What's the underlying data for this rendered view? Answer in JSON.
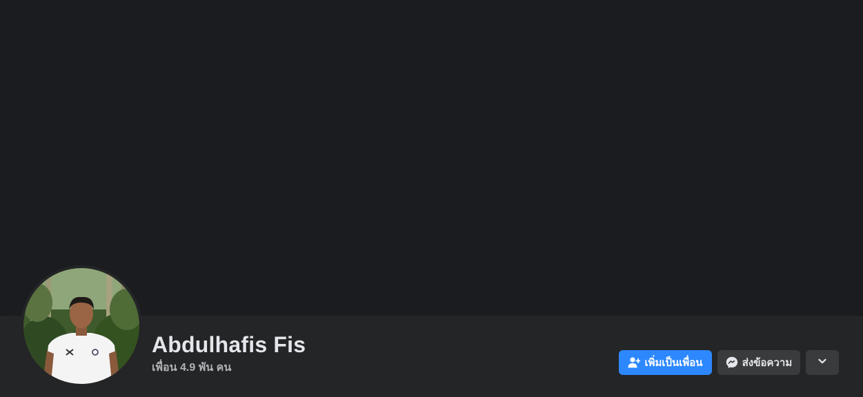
{
  "profile": {
    "name": "Abdulhafis Fis",
    "friend_count": "เพื่อน 4.9 พัน คน",
    "avatar_icon": "profile-photo"
  },
  "actions": {
    "add_friend_label": "เพิ่มเป็นเพื่อน",
    "add_friend_icon": "add-person-icon",
    "message_label": "ส่งข้อความ",
    "message_icon": "messenger-icon",
    "more_icon": "chevron-down-icon"
  },
  "colors": {
    "background": "#18191a",
    "cover": "#1b1c1f",
    "panel": "#242526",
    "primary_button": "#2d88ff",
    "secondary_button": "#3a3b3c",
    "name_text": "#e4e6eb",
    "secondary_text": "#b0b3b8"
  }
}
